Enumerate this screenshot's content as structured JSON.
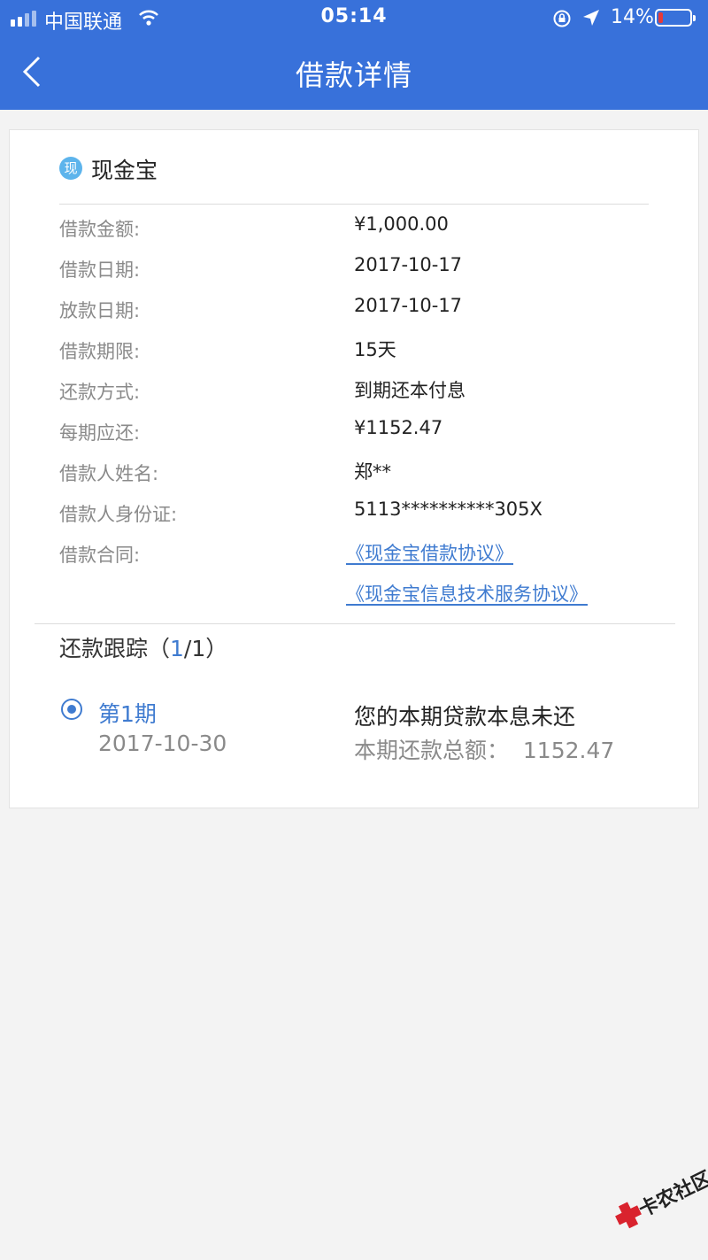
{
  "status_bar": {
    "carrier": "中国联通",
    "time": "05:14",
    "battery_text": "14%",
    "battery_level": 0.14,
    "icons": [
      "signal-icon",
      "wifi-icon",
      "orientation-lock-icon",
      "location-icon",
      "battery-icon"
    ]
  },
  "header": {
    "title": "借款详情",
    "back_icon": "chevron-left-icon"
  },
  "loan": {
    "brand_icon_text": "现",
    "brand_name": "现金宝",
    "rows": [
      {
        "label": "借款金额:",
        "value": "¥1,000.00"
      },
      {
        "label": "借款日期:",
        "value": "2017-10-17"
      },
      {
        "label": "放款日期:",
        "value": "2017-10-17"
      },
      {
        "label": "借款期限:",
        "value": "15天"
      },
      {
        "label": "还款方式:",
        "value": "到期还本付息"
      },
      {
        "label": "每期应还:",
        "value": "¥1152.47"
      },
      {
        "label": "借款人姓名:",
        "value": "郑**"
      },
      {
        "label": "借款人身份证:",
        "value": "5113**********305X"
      }
    ],
    "contract_label": "借款合同:",
    "contracts": [
      "《现金宝借款协议》",
      "《现金宝信息技术服务协议》"
    ]
  },
  "tracking": {
    "title_prefix": "还款跟踪（",
    "current": "1",
    "title_suffix": "/1）",
    "period_label": "第1期",
    "period_date": "2017-10-30",
    "status": "您的本期贷款本息未还",
    "total": "本期还款总额：  1152.47"
  },
  "watermark": {
    "text": "卡农社区"
  },
  "colors": {
    "header_bg": "#3871da",
    "accent": "#3f7bd0",
    "battery_low": "#e63a3a",
    "page_bg": "#f3f3f3"
  }
}
